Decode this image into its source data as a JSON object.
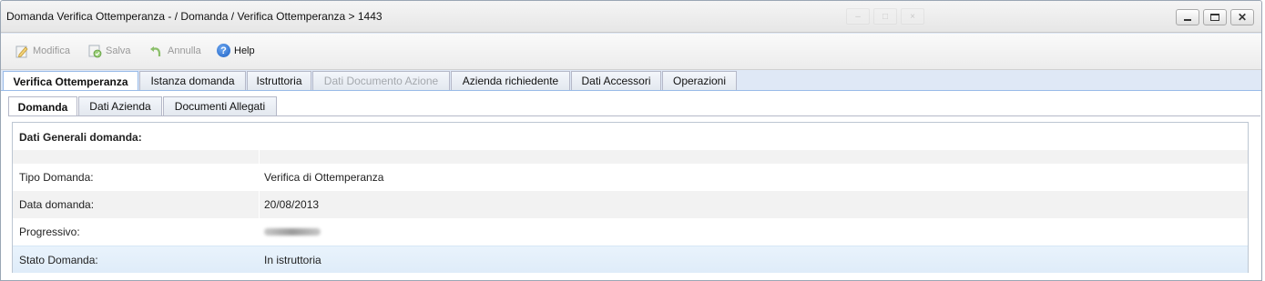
{
  "window": {
    "title": "Domanda Verifica Ottemperanza - / Domanda / Verifica Ottemperanza > 1443"
  },
  "toolbar": {
    "modifica": "Modifica",
    "salva": "Salva",
    "annulla": "Annulla",
    "help": "Help",
    "help_glyph": "?"
  },
  "main_tabs": [
    {
      "label": "Verifica Ottemperanza",
      "state": "active"
    },
    {
      "label": "Istanza domanda",
      "state": "normal"
    },
    {
      "label": "Istruttoria",
      "state": "normal"
    },
    {
      "label": "Dati Documento Azione",
      "state": "disabled"
    },
    {
      "label": "Azienda richiedente",
      "state": "normal"
    },
    {
      "label": "Dati Accessori",
      "state": "normal"
    },
    {
      "label": "Operazioni",
      "state": "normal"
    }
  ],
  "sub_tabs": [
    {
      "label": "Domanda",
      "state": "active"
    },
    {
      "label": "Dati Azienda",
      "state": "normal"
    },
    {
      "label": "Documenti Allegati",
      "state": "normal"
    }
  ],
  "details": {
    "title": "Dati Generali domanda:",
    "rows": [
      {
        "label": "Tipo Domanda:",
        "value": "Verifica di Ottemperanza"
      },
      {
        "label": "Data domanda:",
        "value": "20/08/2013"
      },
      {
        "label": "Progressivo:",
        "value": ""
      },
      {
        "label": "Stato Domanda:",
        "value": "In istruttoria"
      }
    ]
  },
  "icons": {
    "modifica": "edit-icon",
    "salva": "save-icon",
    "annulla": "undo-icon",
    "help": "help-icon"
  },
  "colors": {
    "tab_active_border": "#99bbe8",
    "selected_row": "#e3eefa",
    "help_icon": "#1a5fc4"
  }
}
